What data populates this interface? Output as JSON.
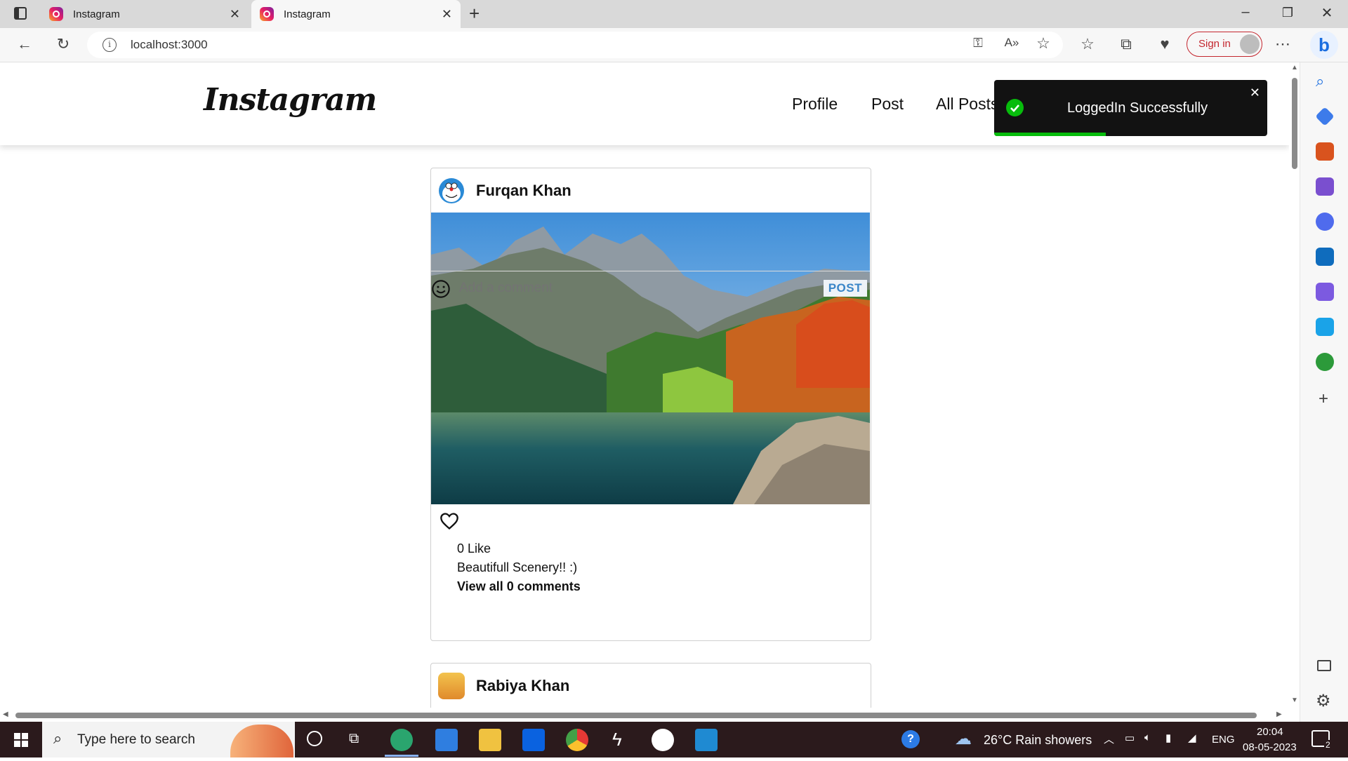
{
  "browser": {
    "tabs": [
      {
        "title": "Instagram",
        "active": false
      },
      {
        "title": "Instagram",
        "active": true
      }
    ],
    "url": "localhost:3000",
    "signin_label": "Sign in"
  },
  "app": {
    "logo": "Instagram",
    "nav": [
      "Profile",
      "Post",
      "All Posts"
    ]
  },
  "toast": {
    "message": "LoggedIn Successfully",
    "progress_fraction": 0.41
  },
  "posts": [
    {
      "author": "Furqan Khan",
      "likes_text": "0 Like",
      "caption": "Beautifull Scenery!! :)",
      "comments_link": "View all 0 comments",
      "comment_placeholder": "Add a comment",
      "post_label": "POST"
    },
    {
      "author": "Rabiya Khan"
    }
  ],
  "taskbar": {
    "search_placeholder": "Type here to search",
    "weather": "26°C  Rain showers",
    "lang": "ENG",
    "time": "20:04",
    "date": "08-05-2023",
    "notifications": "2"
  }
}
